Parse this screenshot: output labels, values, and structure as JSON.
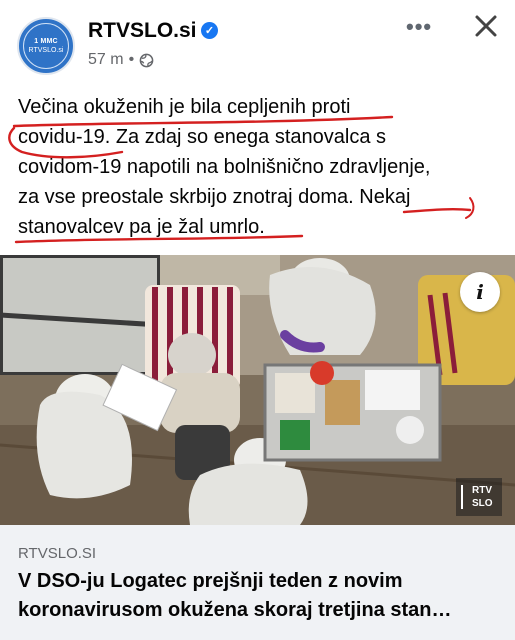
{
  "post": {
    "page_name": "RTVSLO.si",
    "avatar": {
      "top_text": "1 MMC",
      "bottom_text": "RTVSLO.si"
    },
    "verified_icon": "check-icon",
    "timestamp": "57 m",
    "separator": "•",
    "privacy_icon": "globe-icon",
    "more_label": "•••",
    "close_icon": "close-icon",
    "text_lines": [
      "Večina okuženih je bila cepljenih proti",
      "covidu-19. Za zdaj so enega stanovalca s",
      "covidom-19 napotili na bolnišnično zdravljenje,",
      "za vse preostale skrbijo znotraj doma. Nekaj",
      "stanovalcev pa je žal umrlo."
    ],
    "annotation_color": "#d42020"
  },
  "photo": {
    "info_label": "i",
    "watermark_line1": "RTV",
    "watermark_line2": "SLO"
  },
  "link": {
    "domain": "RTVSLO.SI",
    "title_lines": [
      "V DSO-ju Logatec prejšnji teden z novim",
      "koronavirusom okužena skoraj tretjina stan…"
    ]
  }
}
